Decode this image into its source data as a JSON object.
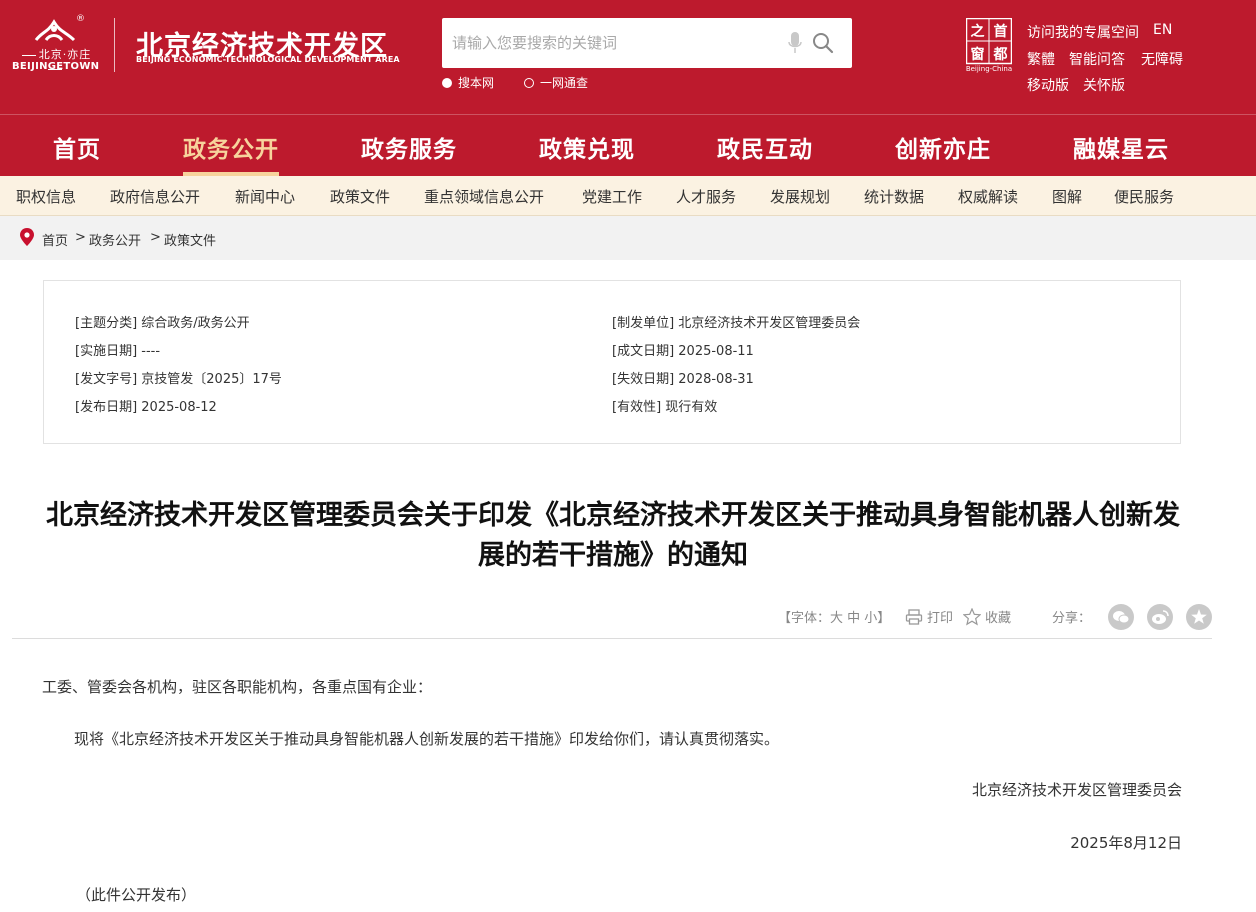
{
  "header": {
    "logo_cn": "北京·亦庄",
    "logo_en": "BEIJINGETOWN",
    "logo_reg": "®",
    "site_title": "北京经济技术开发区",
    "site_title_en": "BEIJING ECONOMIC-TECHNOLOGICAL DEVELOPMENT AREA",
    "search": {
      "placeholder": "请输入您要搜索的关键词",
      "scopes": [
        "搜本网",
        "一网通查"
      ]
    },
    "capital_logo_text": "首都之窗",
    "capital_logo_chars": [
      "之",
      "首",
      "窗",
      "都"
    ],
    "capital_logo_sub": "Beijing-China",
    "top_links": [
      "访问我的专属空间",
      "EN",
      "繁體",
      "智能问答",
      "无障碍",
      "移动版",
      "关怀版"
    ]
  },
  "nav": {
    "items": [
      "首页",
      "政务公开",
      "政务服务",
      "政策兑现",
      "政民互动",
      "创新亦庄",
      "融媒星云"
    ],
    "active": "政务公开"
  },
  "subnav": {
    "items": [
      "职权信息",
      "政府信息公开",
      "新闻中心",
      "政策文件",
      "重点领域信息公开",
      "党建工作",
      "人才服务",
      "发展规划",
      "统计数据",
      "权威解读",
      "图解",
      "便民服务"
    ]
  },
  "breadcrumb": {
    "items": [
      "首页",
      "政务公开",
      "政策文件"
    ],
    "separator": ">"
  },
  "info": {
    "topic": "[主题分类] 综合政务/政务公开",
    "issuer": "[制发单位] 北京经济技术开发区管理委员会",
    "effective_date": "[实施日期] ----",
    "created_date": "[成文日期] 2025-08-11",
    "doc_number": "[发文字号] 京技管发〔2025〕17号",
    "expiry_date": "[失效日期] 2028-08-31",
    "publish_date": "[发布日期] 2025-08-12",
    "validity": "[有效性] 现行有效"
  },
  "article": {
    "title_line1": "北京经济技术开发区管理委员会关于印发《北京经济技术开发区关于推动具身智能机器人创新发",
    "title_line2": "展的若干措施》的通知",
    "tools": {
      "font_label": "【字体：大 中 小】",
      "print": "打印",
      "favorite": "收藏",
      "share": "分享："
    },
    "salutation": "工委、管委会各机构，驻区各职能机构，各重点国有企业：",
    "body": "现将《北京经济技术开发区关于推动具身智能机器人创新发展的若干措施》印发给你们，请认真贯彻落实。",
    "signature": "北京经济技术开发区管理委员会",
    "date": "2025年8月12日",
    "note": "（此件公开发布）"
  },
  "colors": {
    "brand_red": "#bd1a2d",
    "nav_active_gold": "#f7d39c",
    "subnav_bg": "#fbf2e2",
    "breadcrumb_bg": "#f2f2f2"
  },
  "icons": [
    "mic-icon",
    "search-icon",
    "location-pin-icon",
    "print-icon",
    "star-icon",
    "wechat-icon",
    "weibo-icon",
    "favorite-icon"
  ]
}
